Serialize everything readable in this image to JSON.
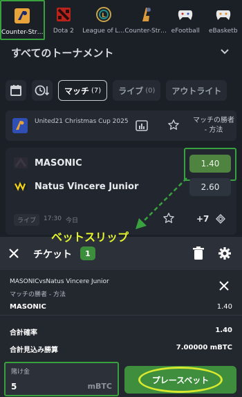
{
  "games": [
    {
      "label": "Counter-Str…",
      "icon": "counter-strike-icon",
      "active": true
    },
    {
      "label": "Dota 2",
      "icon": "dota2-icon"
    },
    {
      "label": "League of L…",
      "icon": "league-of-legends-icon"
    },
    {
      "label": "Counter-Str…",
      "icon": "counter-strike-2-icon"
    },
    {
      "label": "eFootball",
      "icon": "efootball-icon"
    },
    {
      "label": "eBasketb",
      "icon": "ebasketball-icon"
    }
  ],
  "tournament_header": "すべてのトーナメント",
  "filters": {
    "chips": [
      {
        "label": "マッチ",
        "count": "(7)",
        "active": true
      },
      {
        "label": "ライブ",
        "count": "(0)"
      },
      {
        "label": "アウトライト",
        "count": ""
      }
    ]
  },
  "tournament": {
    "name": "United21 Christmas Cup 2025",
    "market_header": "マッチの勝者 - 方法"
  },
  "match": {
    "team1": "MASONIC",
    "team2": "Natus Vincere Junior",
    "odd1": "1.40",
    "odd2": "2.60",
    "live_label": "ライブ",
    "time": "17:30",
    "day": "今日",
    "more_markets": "+7"
  },
  "annotation": "ベットスリップ",
  "bet_slip": {
    "title": "チケット",
    "count": "1",
    "match": "MASONICvsNatus Vincere Junior",
    "market": "マッチの勝者 - 方法",
    "selection": "MASONIC",
    "odd": "1.40",
    "total_odds_label": "合計確率",
    "total_odds_value": "1.40",
    "potential_win_label": "合計見込み勝算",
    "potential_win_value": "7.00000 mBTC",
    "stake_label": "賭け金",
    "stake_value": "5",
    "stake_unit": "mBTC",
    "place_bet_label": "プレースベット"
  },
  "colors": {
    "background": "#1b1f26",
    "accent_green": "#3e8e3d",
    "highlight_outline": "#3aa13f",
    "annotation_yellow": "#e5f52c"
  }
}
